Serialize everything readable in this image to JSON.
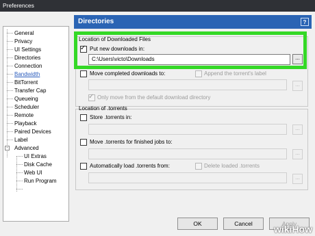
{
  "window": {
    "title": "Preferences"
  },
  "sidebar": {
    "items": [
      {
        "label": "General",
        "selected": false
      },
      {
        "label": "Privacy",
        "selected": false
      },
      {
        "label": "UI Settings",
        "selected": false
      },
      {
        "label": "Directories",
        "selected": false
      },
      {
        "label": "Connection",
        "selected": false
      },
      {
        "label": "Bandwidth",
        "selected": true
      },
      {
        "label": "BitTorrent",
        "selected": false
      },
      {
        "label": "Transfer Cap",
        "selected": false
      },
      {
        "label": "Queueing",
        "selected": false
      },
      {
        "label": "Scheduler",
        "selected": false
      },
      {
        "label": "Remote",
        "selected": false
      },
      {
        "label": "Playback",
        "selected": false
      },
      {
        "label": "Paired Devices",
        "selected": false
      },
      {
        "label": "Label",
        "selected": false
      },
      {
        "label": "Advanced",
        "selected": false,
        "expander": "-"
      },
      {
        "label": "UI Extras",
        "selected": false
      },
      {
        "label": "Disk Cache",
        "selected": false
      },
      {
        "label": "Web UI",
        "selected": false
      },
      {
        "label": "Run Program",
        "selected": false
      }
    ]
  },
  "panel": {
    "header": "Directories",
    "help_icon": "?",
    "downloaded_group": {
      "title": "Location of Downloaded Files",
      "put_new_downloads_label": "Put new downloads in:",
      "put_new_downloads_checked": true,
      "download_path": "C:\\Users\\victo\\Downloads",
      "move_completed_label": "Move completed downloads to:",
      "move_completed_checked": false,
      "append_label_label": "Append the torrent's label",
      "append_label_checked": false,
      "completed_path": "",
      "only_move_default_label": "Only move from the default download directory",
      "only_move_default_checked": true
    },
    "torrents_group": {
      "title": "Location of .torrents",
      "store_label": "Store .torrents in:",
      "store_checked": false,
      "store_path": "",
      "move_finished_label": "Move .torrents for finished jobs to:",
      "move_finished_checked": false,
      "move_finished_path": "",
      "auto_load_label": "Automatically load .torrents from:",
      "auto_load_checked": false,
      "delete_loaded_label": "Delete loaded .torrents",
      "delete_loaded_checked": false,
      "auto_load_path": ""
    },
    "browse_label": "..."
  },
  "buttons": {
    "ok": "OK",
    "cancel": "Cancel",
    "apply": "Apply"
  },
  "watermark": "wikiHow",
  "colors": {
    "header": "#2a64b4",
    "highlight": "#34d826",
    "titlebar": "#2f3136"
  }
}
